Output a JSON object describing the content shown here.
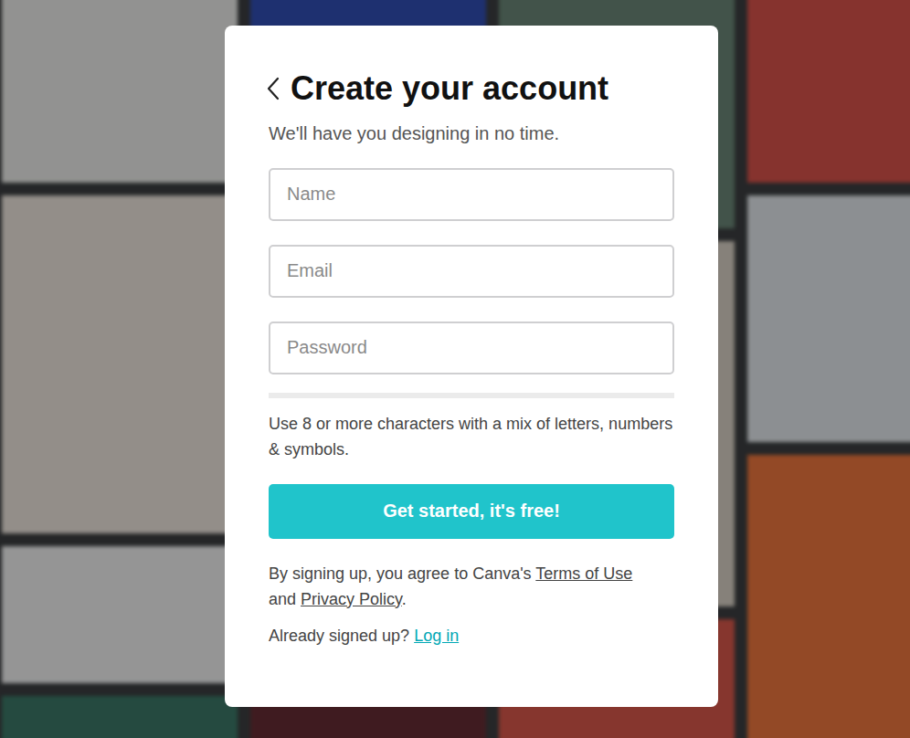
{
  "modal": {
    "title": "Create your account",
    "subtitle": "We'll have you designing in no time.",
    "fields": [
      {
        "placeholder": "Name",
        "type": "text",
        "value": ""
      },
      {
        "placeholder": "Email",
        "type": "email",
        "value": ""
      },
      {
        "placeholder": "Password",
        "type": "password",
        "value": ""
      }
    ],
    "password_strength": {
      "level": 0
    },
    "hint": "Use 8 or more characters with a mix of letters, numbers & symbols.",
    "submit": "Get started, it's free!",
    "legal": {
      "prefix": "By signing up, you agree to Canva's",
      "terms": "Terms of Use",
      "middle": "and",
      "privacy": "Privacy Policy",
      "suffix": "."
    },
    "login": {
      "prompt": "Already signed up?",
      "link": "Log in"
    }
  }
}
